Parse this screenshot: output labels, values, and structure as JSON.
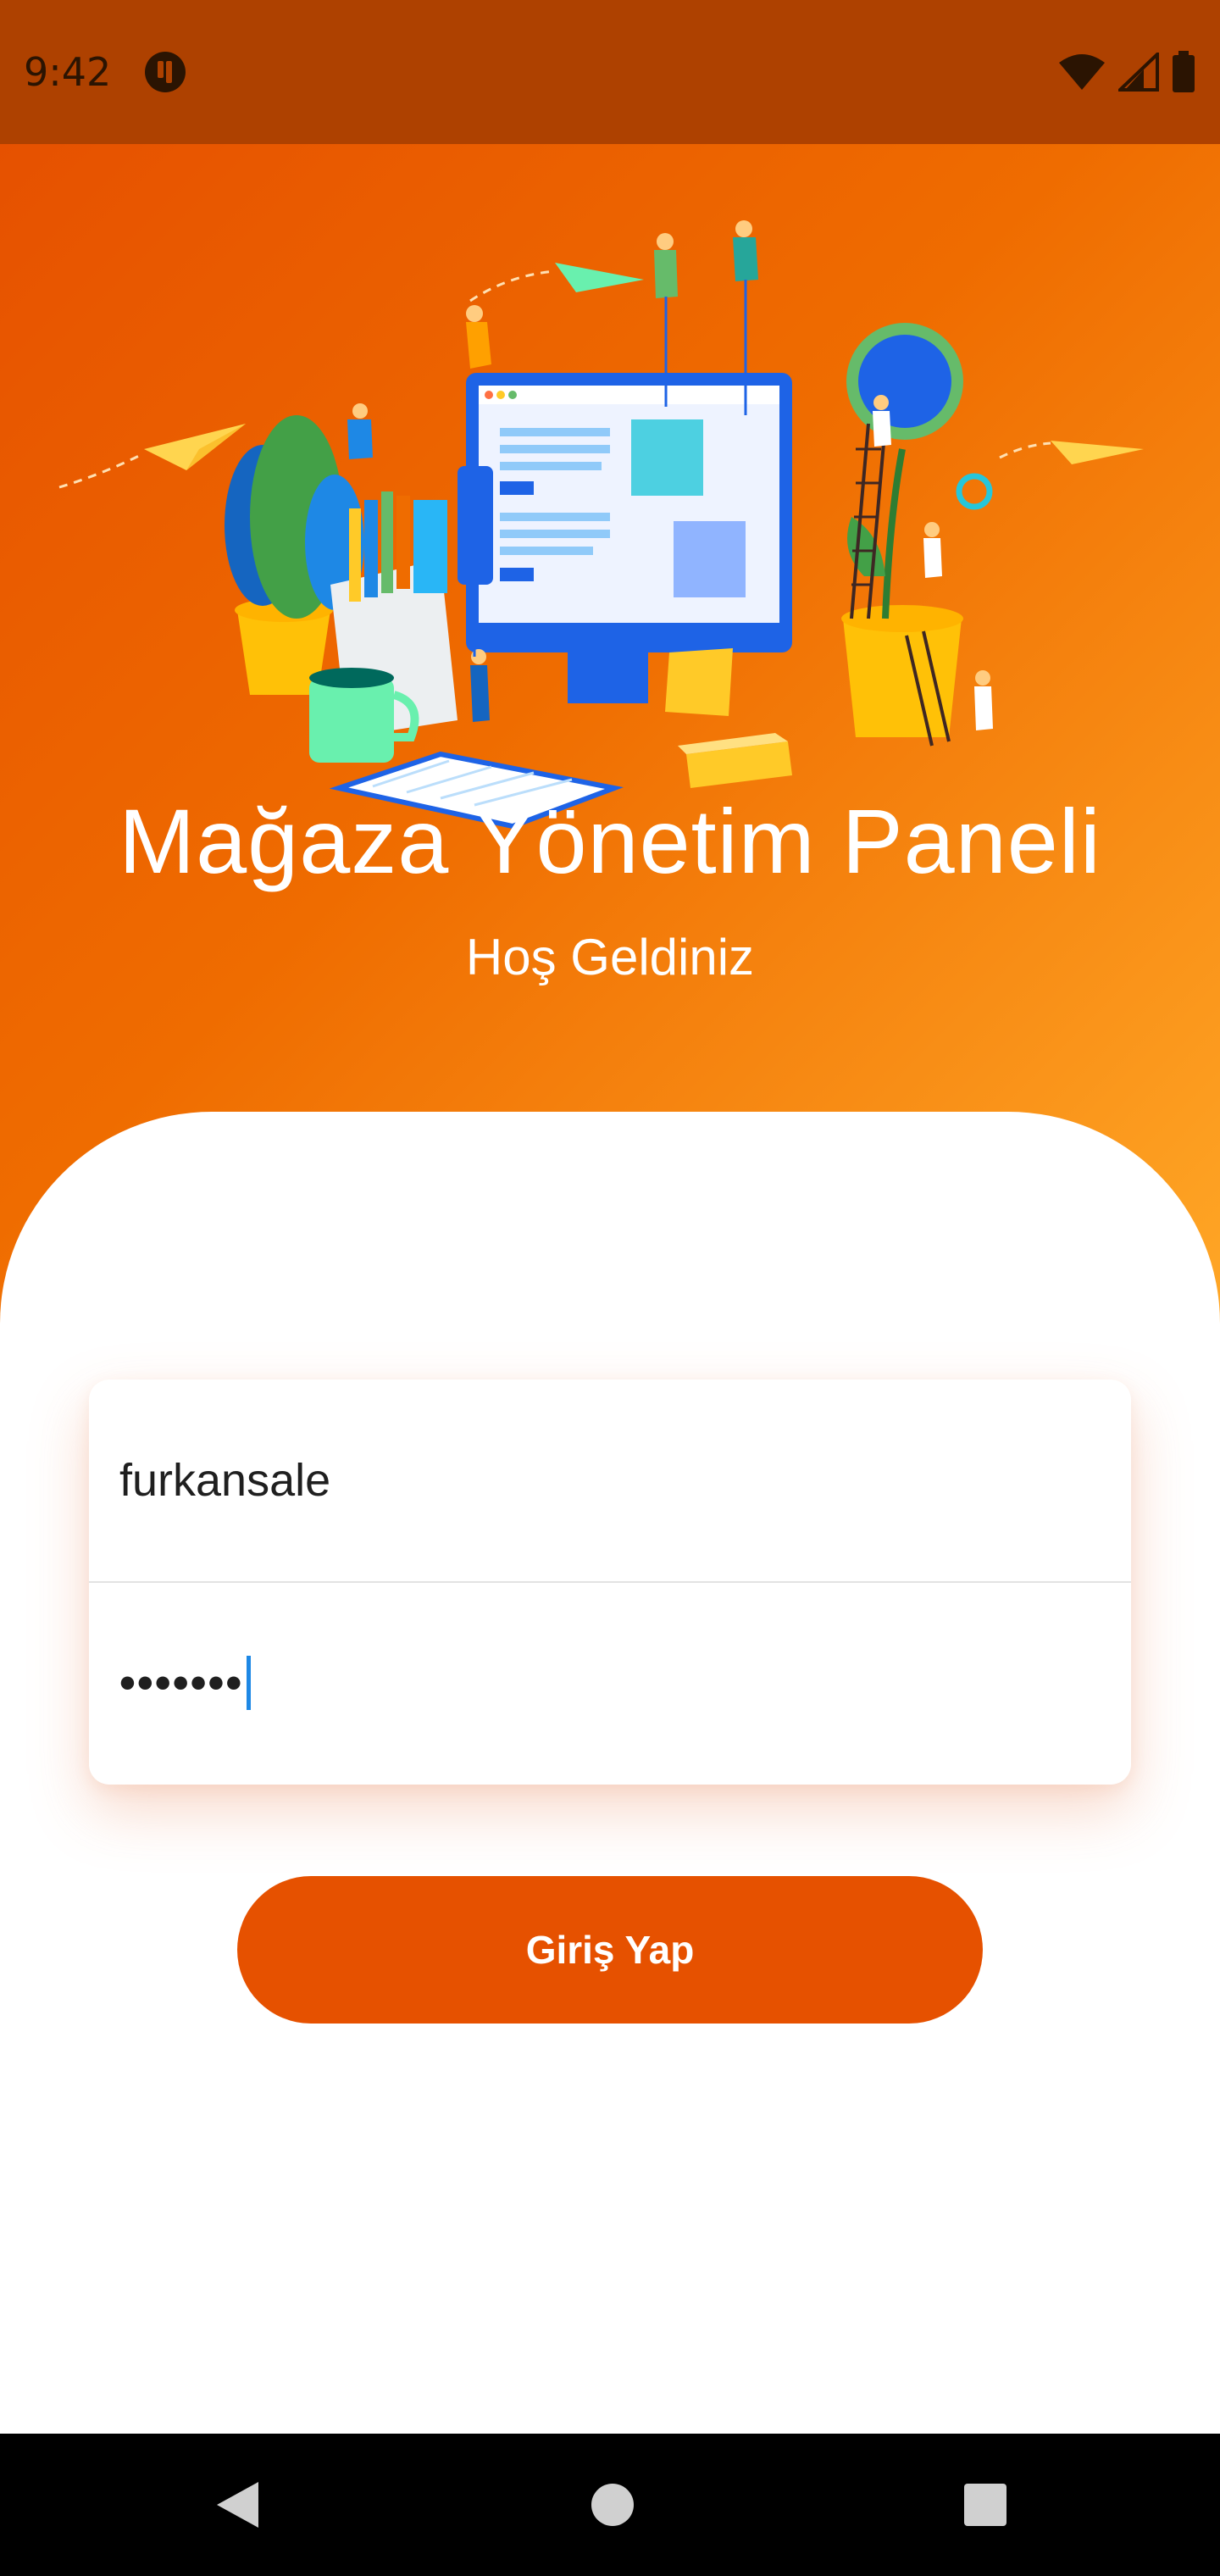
{
  "status_bar": {
    "time": "9:42",
    "icons": [
      "app-notification-icon",
      "wifi-icon",
      "cell-signal-icon",
      "battery-icon"
    ]
  },
  "header": {
    "title": "Mağaza Yönetim Paneli",
    "subtitle": "Hoş Geldiniz"
  },
  "login_form": {
    "username_value": "furkansale",
    "password_value": "•••••••"
  },
  "actions": {
    "login_label": "Giriş Yap"
  },
  "nav_bar": {
    "icons": [
      "back-icon",
      "home-icon",
      "recents-icon"
    ]
  },
  "colors": {
    "primary": "#e65100",
    "status_bar": "#ae4100",
    "gradient_end": "#ffa726",
    "accent_caret": "#1e88e5"
  }
}
